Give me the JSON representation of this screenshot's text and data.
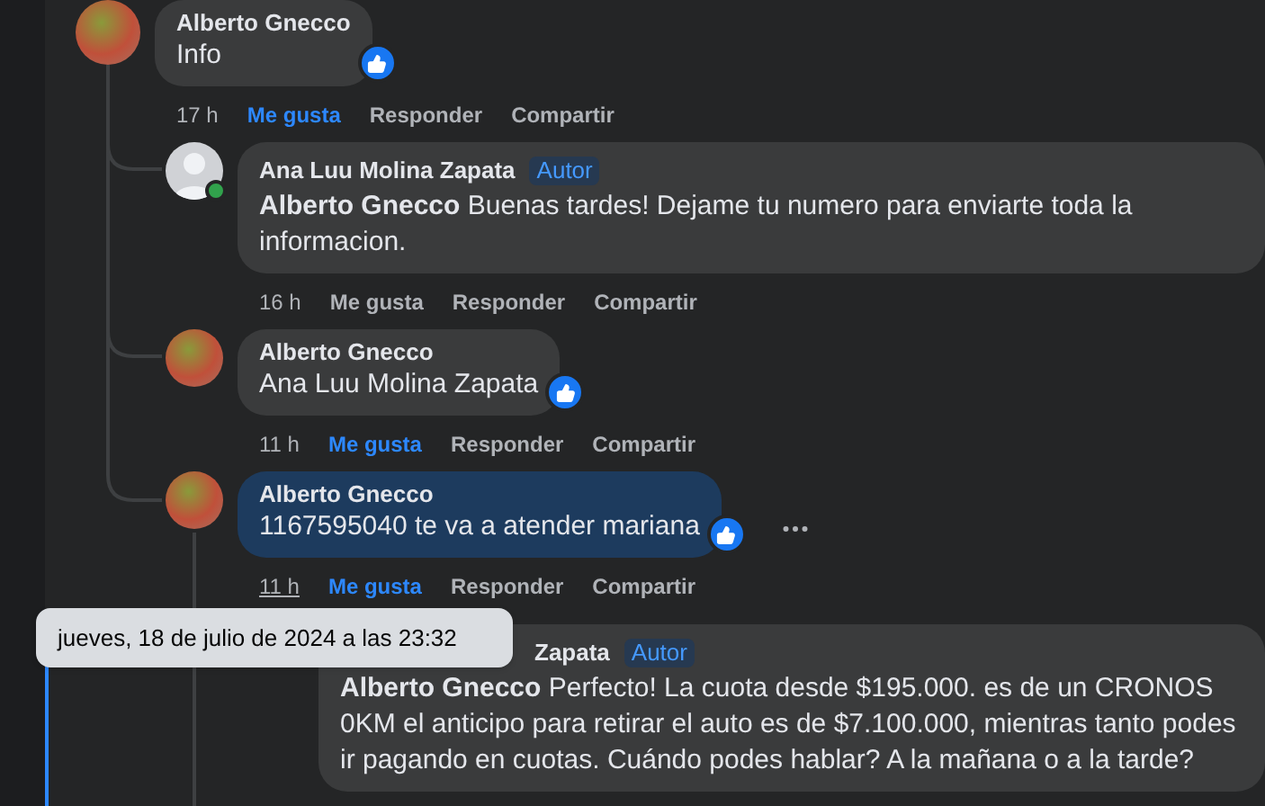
{
  "comments": [
    {
      "author": "Alberto Gnecco",
      "photo_avatar": true,
      "text": "Info",
      "reaction": true,
      "time": "17 h",
      "time_underlined": false,
      "liked": true,
      "like_label": "Me gusta",
      "reply_label": "Responder",
      "share_label": "Compartir",
      "children": [
        {
          "author": "Ana Luu Molina Zapata",
          "author_badge": "Autor",
          "photo_avatar": false,
          "online": true,
          "mention": "Alberto Gnecco",
          "text": "Buenas tardes! Dejame tu numero para enviarte toda la informacion.",
          "time": "16 h",
          "time_underlined": false,
          "liked": false,
          "like_label": "Me gusta",
          "reply_label": "Responder",
          "share_label": "Compartir"
        },
        {
          "author": "Alberto Gnecco",
          "photo_avatar": true,
          "text": "Ana Luu Molina Zapata",
          "reaction": true,
          "time": "11 h",
          "time_underlined": false,
          "liked": true,
          "like_label": "Me gusta",
          "reply_label": "Responder",
          "share_label": "Compartir"
        },
        {
          "author": "Alberto Gnecco",
          "photo_avatar": true,
          "text": "1167595040 te va a atender mariana",
          "reaction": true,
          "highlighted": true,
          "more_menu": true,
          "time": "11 h",
          "time_underlined": true,
          "liked": true,
          "like_label": "Me gusta",
          "reply_label": "Responder",
          "share_label": "Compartir",
          "children": [
            {
              "author": "Zapata",
              "author_badge": "Autor",
              "mention": "Alberto Gnecco",
              "text": "Perfecto! La cuota desde $195.000. es de un CRONOS 0KM el anticipo para retirar el auto es de $7.100.000, mientras tanto podes ir pagando en cuotas. Cuándo podes hablar? A la mañana o a la tarde?"
            }
          ]
        }
      ]
    }
  ],
  "tooltip": {
    "text": "jueves, 18 de julio de 2024 a las 23:32"
  }
}
